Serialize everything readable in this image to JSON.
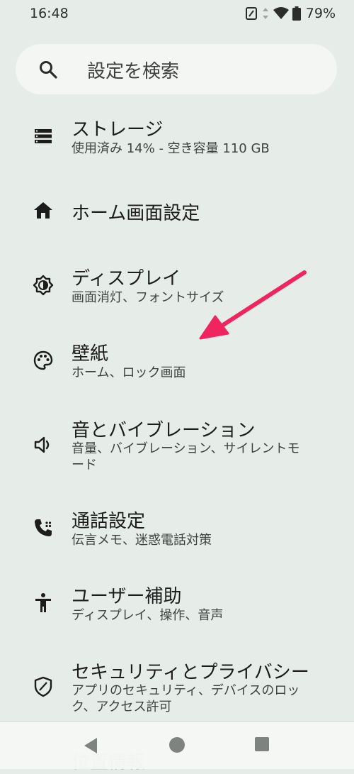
{
  "status": {
    "time": "16:48",
    "battery": "79%"
  },
  "search": {
    "placeholder": "設定を検索"
  },
  "items": [
    {
      "title": "ストレージ",
      "subtitle": "使用済み 14% - 空き容量 110 GB",
      "icon": "storage-icon"
    },
    {
      "title": "ホーム画面設定",
      "subtitle": "",
      "icon": "home-icon"
    },
    {
      "title": "ディスプレイ",
      "subtitle": "画面消灯、フォントサイズ",
      "icon": "brightness-icon"
    },
    {
      "title": "壁紙",
      "subtitle": "ホーム、ロック画面",
      "icon": "palette-icon"
    },
    {
      "title": "音とバイブレーション",
      "subtitle": "音量、バイブレーション、サイレントモード",
      "icon": "volume-icon"
    },
    {
      "title": "通話設定",
      "subtitle": "伝言メモ、迷惑電話対策",
      "icon": "phone-icon"
    },
    {
      "title": "ユーザー補助",
      "subtitle": "ディスプレイ、操作、音声",
      "icon": "accessibility-icon"
    },
    {
      "title": "セキュリティとプライバシー",
      "subtitle": "アプリのセキュリティ、デバイスのロック、アクセス許可",
      "icon": "shield-icon"
    }
  ],
  "peek_item": {
    "title": "位置情報"
  },
  "colors": {
    "background": "#e6ece8",
    "search_bg": "#f3f6f3",
    "annotation_arrow": "#f0245e"
  }
}
